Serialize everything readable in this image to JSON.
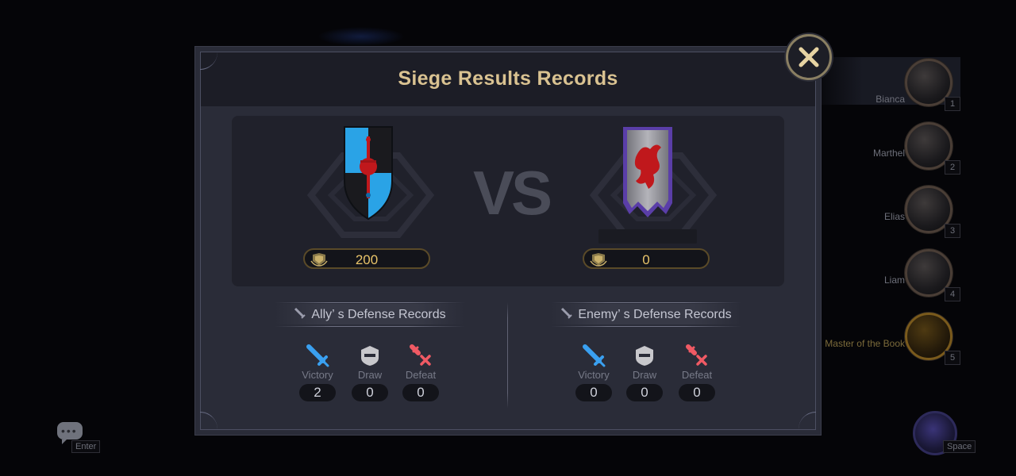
{
  "party": [
    {
      "name": "Bianca",
      "slot": "1"
    },
    {
      "name": "Marthel",
      "slot": "2"
    },
    {
      "name": "Elias",
      "slot": "3"
    },
    {
      "name": "Liam",
      "slot": "4"
    },
    {
      "name": "Master of the Book",
      "slot": "5"
    }
  ],
  "hotkeys": {
    "chat": "Enter",
    "skill": "Space"
  },
  "modal": {
    "title": "Siege Results Records",
    "vs_label": "VS",
    "ally": {
      "score": "200"
    },
    "enemy": {
      "score": "0"
    }
  },
  "ally_records": {
    "header": "Ally’ s Defense Records",
    "victory_label": "Victory",
    "victory": "2",
    "draw_label": "Draw",
    "draw": "0",
    "defeat_label": "Defeat",
    "defeat": "0"
  },
  "enemy_records": {
    "header": "Enemy’ s Defense Records",
    "victory_label": "Victory",
    "victory": "0",
    "draw_label": "Draw",
    "draw": "0",
    "defeat_label": "Defeat",
    "defeat": "0"
  },
  "colors": {
    "title_gold": "#d9c291",
    "score_gold": "#e9c46a",
    "victory_blue": "#3aa0f0",
    "draw_gray": "#c8c8cc",
    "defeat_red": "#f05a64",
    "ally_shield": [
      "#2aa3e6",
      "#1a1a1e"
    ],
    "enemy_emblem": "#c0181c"
  },
  "icons": [
    "close-icon",
    "sword-icon",
    "shield-block-icon",
    "broken-sword-icon",
    "medal-icon",
    "chat-icon"
  ]
}
